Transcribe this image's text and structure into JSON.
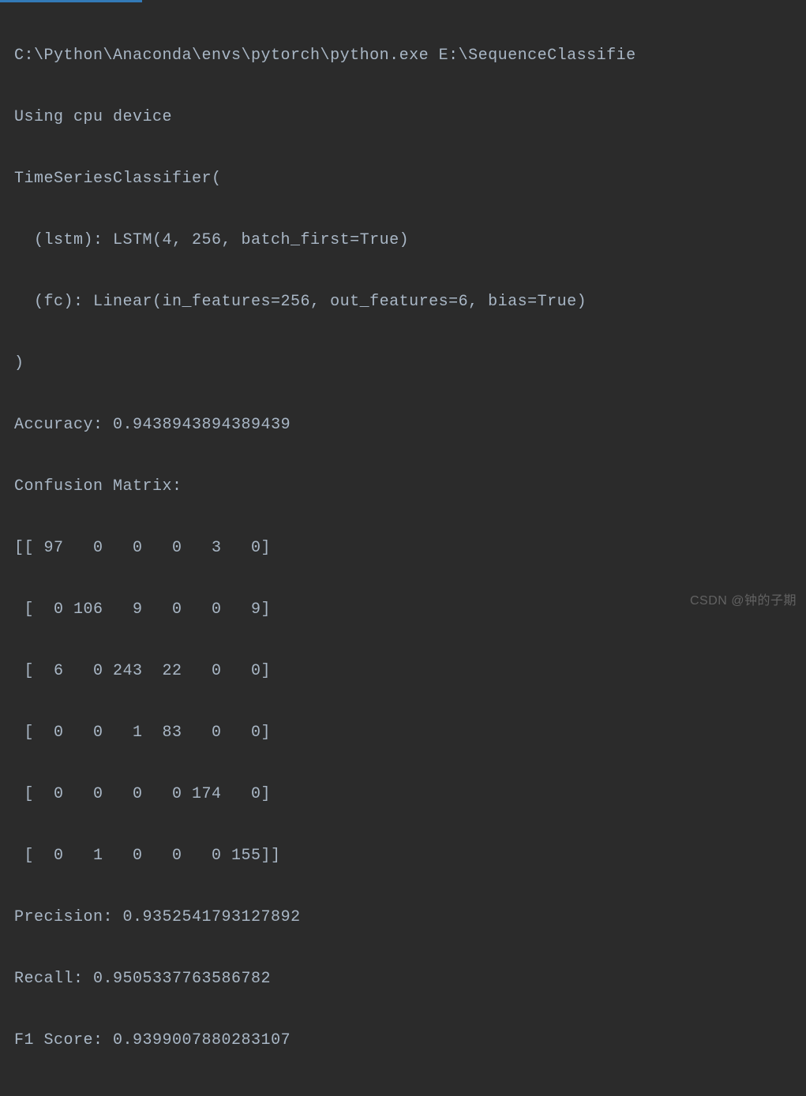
{
  "command_line": "C:\\Python\\Anaconda\\envs\\pytorch\\python.exe E:\\SequenceClassifie",
  "device_line": "Using cpu device",
  "model_header": "TimeSeriesClassifier(",
  "model_lstm": "  (lstm): LSTM(4, 256, batch_first=True)",
  "model_fc": "  (fc): Linear(in_features=256, out_features=6, bias=True)",
  "model_close": ")",
  "accuracy_label": "Accuracy: ",
  "accuracy_value": "0.9438943894389439",
  "confusion_header": "Confusion Matrix:",
  "cm_row0": "[[ 97   0   0   0   3   0]",
  "cm_row1": " [  0 106   9   0   0   9]",
  "cm_row2": " [  6   0 243  22   0   0]",
  "cm_row3": " [  0   0   1  83   0   0]",
  "cm_row4": " [  0   0   0   0 174   0]",
  "cm_row5": " [  0   1   0   0   0 155]]",
  "precision_label": "Precision: ",
  "precision_value": "0.9352541793127892",
  "recall_label": "Recall: ",
  "recall_value": "0.9505337763586782",
  "f1_label": "F1 Score: ",
  "f1_value": "0.9399007880283107",
  "watermark_text": "CSDN @钟的子期",
  "confusion_matrix_data": {
    "rows": [
      [
        97,
        0,
        0,
        0,
        3,
        0
      ],
      [
        0,
        106,
        9,
        0,
        0,
        9
      ],
      [
        6,
        0,
        243,
        22,
        0,
        0
      ],
      [
        0,
        0,
        1,
        83,
        0,
        0
      ],
      [
        0,
        0,
        0,
        0,
        174,
        0
      ],
      [
        0,
        1,
        0,
        0,
        0,
        155
      ]
    ]
  },
  "metrics": {
    "accuracy": 0.9438943894389439,
    "precision": 0.9352541793127892,
    "recall": 0.9505337763586782,
    "f1_score": 0.9399007880283107
  }
}
